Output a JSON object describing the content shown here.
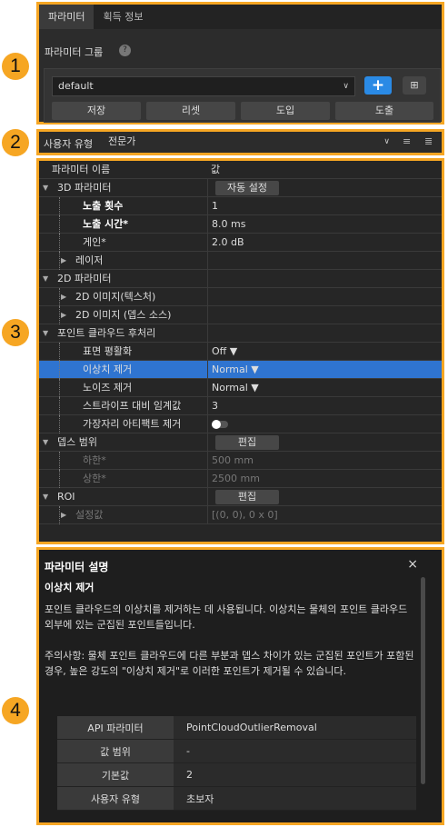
{
  "callouts": [
    "1",
    "2",
    "3",
    "4"
  ],
  "tabs": [
    "파라미터",
    "획득 정보"
  ],
  "group": {
    "title": "파라미터 그룹",
    "help": "?",
    "selected": "default",
    "add": "+",
    "grid": "⊞",
    "buttons": [
      "저장",
      "리셋",
      "도입",
      "도출"
    ]
  },
  "user_type": {
    "label": "사용자 유형",
    "value": "전문가"
  },
  "tree": {
    "header": {
      "name": "파라미터 이름",
      "value": "값"
    },
    "rows": [
      {
        "name": "3D 파라미터",
        "value": "자동 설정",
        "level": 0,
        "arrow": "▼",
        "button": true
      },
      {
        "name": "노출 횟수",
        "value": "1",
        "level": 1,
        "bold": true
      },
      {
        "name": "노출 시간*",
        "value": "8.0 ms",
        "level": 1,
        "bold": true
      },
      {
        "name": "게인*",
        "value": "2.0 dB",
        "level": 1
      },
      {
        "name": "레이저",
        "value": "",
        "level": 1,
        "arrow": "▶"
      },
      {
        "name": "2D 파라미터",
        "value": "",
        "level": 0,
        "arrow": "▼"
      },
      {
        "name": "2D 이미지(텍스처)",
        "value": "",
        "level": 1,
        "arrow": "▶"
      },
      {
        "name": "2D 이미지 (뎁스 소스)",
        "value": "",
        "level": 1,
        "arrow": "▶"
      },
      {
        "name": "포인트 클라우드 후처리",
        "value": "",
        "level": 0,
        "arrow": "▼"
      },
      {
        "name": "표면 평활화",
        "value": "Off ▼",
        "level": 1
      },
      {
        "name": "이상치 제거",
        "value": "Normal ▼",
        "level": 1,
        "selected": true
      },
      {
        "name": "노이즈 제거",
        "value": "Normal ▼",
        "level": 1
      },
      {
        "name": "스트라이프 대비 임계값",
        "value": "3",
        "level": 1
      },
      {
        "name": "가장자리 아티팩트 제거",
        "value": "",
        "level": 1,
        "toggle": true
      },
      {
        "name": "뎁스 범위",
        "value": "편집",
        "level": 0,
        "arrow": "▼",
        "button": true
      },
      {
        "name": "하한*",
        "value": "500 mm",
        "level": 1,
        "dim": true
      },
      {
        "name": "상한*",
        "value": "2500 mm",
        "level": 1,
        "dim": true
      },
      {
        "name": "ROI",
        "value": "편집",
        "level": 0,
        "arrow": "▼",
        "button": true
      },
      {
        "name": "설정값",
        "value": "[(0, 0), 0 x 0]",
        "level": 1,
        "arrow": "▶",
        "dim": true
      }
    ]
  },
  "description": {
    "title": "파라미터 설명",
    "close": "×",
    "subtitle": "이상치 제거",
    "para1": "포인트 클라우드의 이상치를 제거하는 데 사용됩니다. 이상치는 물체의 포인트 클라우드 외부에 있는 군집된 포인트들입니다.",
    "para2": "주의사항: 물체 포인트 클라우드에 다른 부분과 뎁스 차이가 있는 군집된 포인트가 포함된 경우, 높은 강도의 \"이상치 제거\"로 이러한 포인트가 제거될 수 있습니다.",
    "table": [
      {
        "key": "API 파라미터",
        "value": "PointCloudOutlierRemoval"
      },
      {
        "key": "값 범위",
        "value": "-"
      },
      {
        "key": "기본값",
        "value": "2"
      },
      {
        "key": "사용자 유형",
        "value": "초보자"
      }
    ]
  }
}
